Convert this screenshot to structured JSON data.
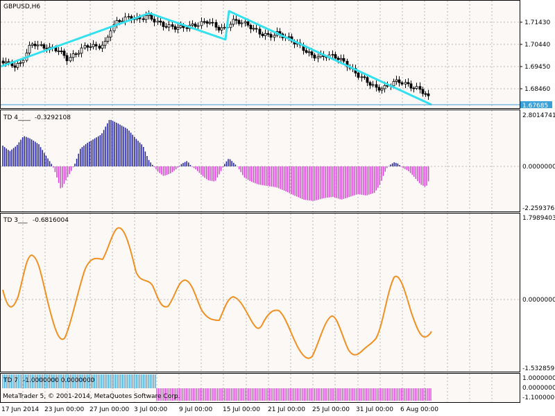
{
  "header": {
    "symbol_label": "GBPUSD,H6"
  },
  "main_chart": {
    "price_axis": [
      "1.71430",
      "1.70440",
      "1.69450",
      "1.68460"
    ],
    "current_price": "1.67685",
    "trend_line_color": "#32e0f0",
    "bull_bar_color": "#ffffff",
    "bear_bar_color": "#000000"
  },
  "indicators": [
    {
      "name": "TD 4____",
      "value": "-0.3292108",
      "axis": [
        "2.8014741",
        "0.0000000",
        "-2.2593765"
      ],
      "colors": {
        "positive": "#1c1c9c",
        "negative": "#d840d8"
      }
    },
    {
      "name": "TD 3___",
      "value": "-0.6816004",
      "axis": [
        "1.7989403",
        "0.0000000",
        "-1.5328591"
      ],
      "colors": {
        "line": "#f09020"
      }
    },
    {
      "name": "TD 7",
      "value": "-1.0000000 0.0000000",
      "axis": [
        "1.0000000",
        "0.0000000",
        "-1.1000000"
      ],
      "colors": {
        "positive": "#3aa0d8",
        "negative": "#d840d8"
      }
    }
  ],
  "time_axis": [
    "17 Jun 2014",
    "23 Jun 00:00",
    "27 Jun 00:00",
    "3 Jul 00:00",
    "9 Jul 00:00",
    "15 Jul 00:00",
    "21 Jul 00:00",
    "25 Jul 00:00",
    "31 Jul 00:00",
    "6 Aug 00:00"
  ],
  "copyright": "MetaTrader 5, © 2001-2014, MetaQuotes Software Corp."
}
